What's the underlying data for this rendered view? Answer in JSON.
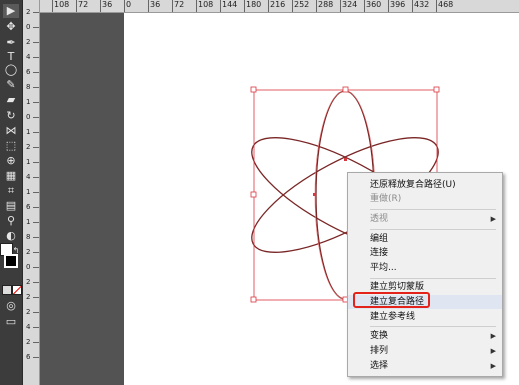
{
  "ruler": {
    "top_labels": [
      "108",
      "72",
      "36",
      "0",
      "36",
      "72",
      "108",
      "144",
      "180",
      "216",
      "252",
      "288",
      "324",
      "360",
      "396",
      "432",
      "468"
    ],
    "left_labels": [
      "2",
      "0",
      "2",
      "4",
      "6",
      "8",
      "1",
      "0",
      "1",
      "2",
      "1",
      "4",
      "1",
      "6",
      "1",
      "8",
      "2",
      "0",
      "2",
      "2",
      "2",
      "4",
      "2",
      "6"
    ]
  },
  "tools": [
    "selection-tool",
    "direct-selection-tool",
    "pen-tool",
    "type-tool",
    "ellipse-tool",
    "pencil-tool",
    "eraser-tool",
    "rotate-tool",
    "width-tool",
    "free-transform-tool",
    "shape-builder-tool",
    "perspective-tool",
    "mesh-tool",
    "gradient-tool",
    "eyedropper-tool",
    "blend-tool",
    "symbol-sprayer-tool",
    "column-graph-tool",
    "artboard-tool",
    "slice-tool",
    "hand-tool",
    "zoom-tool"
  ],
  "context_menu": {
    "items": [
      {
        "label": "还原释放复合路径(U)",
        "disabled": false,
        "submenu": false
      },
      {
        "label": "重做(R)",
        "disabled": true,
        "submenu": false
      },
      {
        "label": "透视",
        "disabled": true,
        "submenu": true
      },
      {
        "label": "编组",
        "disabled": false,
        "submenu": false
      },
      {
        "label": "连接",
        "disabled": false,
        "submenu": false
      },
      {
        "label": "平均...",
        "disabled": false,
        "submenu": false
      },
      {
        "label": "建立剪切蒙版",
        "disabled": false,
        "submenu": false
      },
      {
        "label": "建立复合路径",
        "disabled": false,
        "submenu": false,
        "highlighted": true
      },
      {
        "label": "建立参考线",
        "disabled": false,
        "submenu": false
      },
      {
        "label": "变换",
        "disabled": false,
        "submenu": true
      },
      {
        "label": "排列",
        "disabled": false,
        "submenu": true
      },
      {
        "label": "选择",
        "disabled": false,
        "submenu": true
      }
    ]
  },
  "colors": {
    "selection": "#d9363e",
    "path": "#8a2a2a",
    "highlight_box": "#e4221c"
  }
}
